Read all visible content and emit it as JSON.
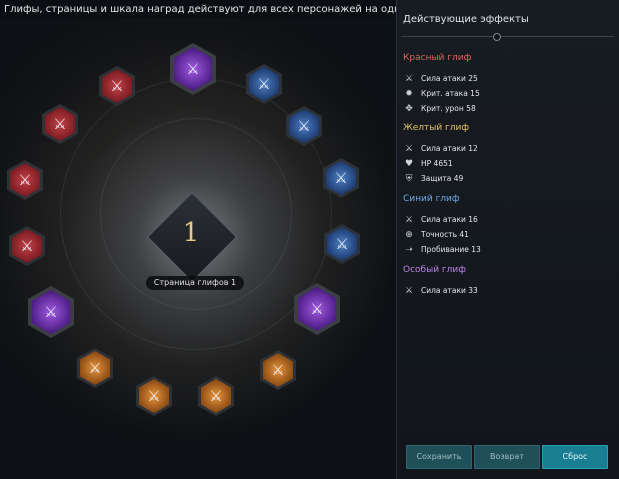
{
  "notice": "Глифы, страницы и шкала наград действуют для всех персонажей на одном сервере.",
  "glyph_page": {
    "number": "1",
    "label": "Страница глифов 1"
  },
  "glyph_slots": [
    {
      "color": "purple",
      "icon": "crossed-swords-icon"
    },
    {
      "color": "blue",
      "icon": "crossed-swords-icon"
    },
    {
      "color": "blue",
      "icon": "crossed-swords-icon"
    },
    {
      "color": "blue",
      "icon": "crossed-swords-icon"
    },
    {
      "color": "blue",
      "icon": "crossed-swords-icon"
    },
    {
      "color": "purple",
      "icon": "crossed-swords-icon"
    },
    {
      "color": "orange",
      "icon": "crossed-swords-icon"
    },
    {
      "color": "orange",
      "icon": "crossed-swords-icon"
    },
    {
      "color": "orange",
      "icon": "crossed-swords-icon"
    },
    {
      "color": "orange",
      "icon": "crossed-swords-icon"
    },
    {
      "color": "purple",
      "icon": "crossed-swords-icon"
    },
    {
      "color": "red",
      "icon": "crossed-swords-icon"
    },
    {
      "color": "red",
      "icon": "crossed-swords-icon"
    },
    {
      "color": "red",
      "icon": "crossed-swords-icon"
    },
    {
      "color": "red",
      "icon": "crossed-swords-icon"
    }
  ],
  "panel": {
    "title": "Действующие эффекты",
    "sections": [
      {
        "title": "Красный глиф",
        "color": "#e5635a",
        "stats": [
          {
            "icon": "crossed-swords-icon",
            "text": "Сила атаки 25"
          },
          {
            "icon": "crit-burst-icon",
            "text": "Крит. атака 15"
          },
          {
            "icon": "crit-damage-icon",
            "text": "Крит. урон 58"
          }
        ]
      },
      {
        "title": "Желтый глиф",
        "color": "#e4c262",
        "stats": [
          {
            "icon": "crossed-swords-icon",
            "text": "Сила атаки 12"
          },
          {
            "icon": "heart-icon",
            "text": "HP 4651"
          },
          {
            "icon": "shield-icon",
            "text": "Защита 49"
          }
        ]
      },
      {
        "title": "Синий глиф",
        "color": "#6fa8e6",
        "stats": [
          {
            "icon": "crossed-swords-icon",
            "text": "Сила атаки 16"
          },
          {
            "icon": "crosshair-icon",
            "text": "Точность 41"
          },
          {
            "icon": "pierce-arrow-icon",
            "text": "Пробивание 13"
          }
        ]
      },
      {
        "title": "Особый глиф",
        "color": "#b984e8",
        "stats": [
          {
            "icon": "crossed-swords-icon",
            "text": "Сила атаки 33"
          }
        ]
      }
    ],
    "buttons": {
      "save": "Сохранить",
      "revert": "Возврат",
      "reset": "Сброс"
    }
  }
}
